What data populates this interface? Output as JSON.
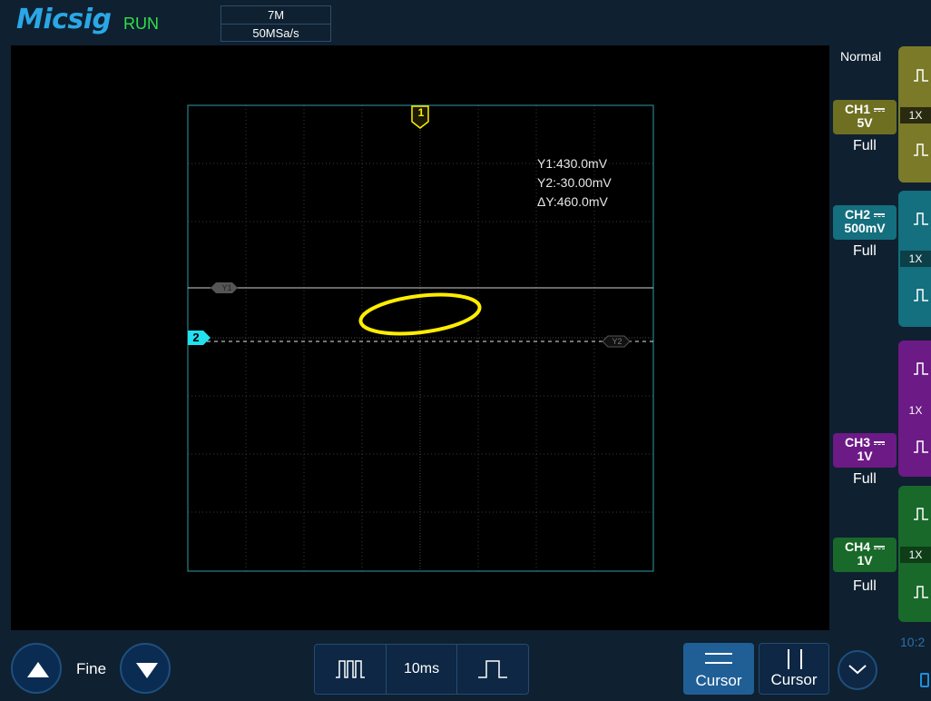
{
  "header": {
    "logo": "Micsig",
    "status": "RUN",
    "memory_depth": "7M",
    "sample_rate": "50MSa/s"
  },
  "trigger": {
    "mode": "Normal"
  },
  "channels": [
    {
      "id": "CH1",
      "scale": "5V",
      "bandwidth": "Full",
      "probe": "1X",
      "color": "#7a7a28"
    },
    {
      "id": "CH2",
      "scale": "500mV",
      "bandwidth": "Full",
      "probe": "1X",
      "color": "#146f7e"
    },
    {
      "id": "CH3",
      "scale": "1V",
      "bandwidth": "Full",
      "probe": "1X",
      "color": "#6c1a86"
    },
    {
      "id": "CH4",
      "scale": "1V",
      "bandwidth": "Full",
      "probe": "1X",
      "color": "#19692a"
    }
  ],
  "cursor_readout": {
    "y1": "Y1:430.0mV",
    "y2": "Y2:-30.00mV",
    "delta_y": "ΔY:460.0mV"
  },
  "markers": {
    "ch1_marker": "1",
    "ch2_marker": "2",
    "y1_label": "Y1",
    "y2_label": "Y2"
  },
  "bottom": {
    "fine_label": "Fine",
    "timebase": "10ms",
    "cursor_h_label": "Cursor",
    "cursor_v_label": "Cursor",
    "clock": "10:2"
  },
  "icons": {
    "up": "triangle-up-icon",
    "down": "triangle-down-icon",
    "pulse_train": "pulse-train-icon",
    "single_pulse": "single-pulse-icon",
    "chevron": "chevron-down-icon"
  },
  "colors": {
    "ch1": "#ffff1a",
    "ch2": "#22e0f0",
    "grid_border": "#2e9aa6",
    "logo": "#2aa7e6",
    "run": "#2fe04a"
  }
}
